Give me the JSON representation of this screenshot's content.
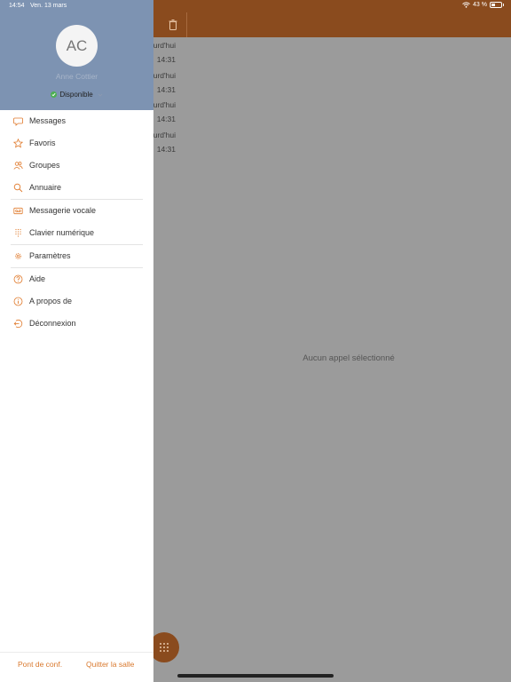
{
  "status_bar": {
    "time": "14:54",
    "date": "Ven. 13 mars",
    "battery": "43 %",
    "battery_level": 0.43
  },
  "background": {
    "calls": [
      {
        "day": "urd'hui",
        "time": "14:31"
      },
      {
        "day": "urd'hui",
        "time": "14:31"
      },
      {
        "day": "urd'hui",
        "time": "14:31"
      },
      {
        "day": "urd'hui",
        "time": "14:31"
      }
    ],
    "empty_message": "Aucun appel sélectionné"
  },
  "profile": {
    "initials": "AC",
    "name": "Anne Cottier",
    "presence": "Disponible"
  },
  "menu": {
    "messages": "Messages",
    "favorites": "Favoris",
    "groups": "Groupes",
    "directory": "Annuaire",
    "voicemail": "Messagerie vocale",
    "keypad": "Clavier numérique",
    "settings": "Paramètres",
    "help": "Aide",
    "about": "A propos de",
    "logout": "Déconnexion"
  },
  "bottom": {
    "conference": "Pont de conf.",
    "leave_room": "Quitter la salle"
  },
  "colors": {
    "accent": "#e07a2c",
    "header_bg": "#8a4b1e",
    "profile_bg": "#7d93b2",
    "presence": "#4caf50"
  }
}
